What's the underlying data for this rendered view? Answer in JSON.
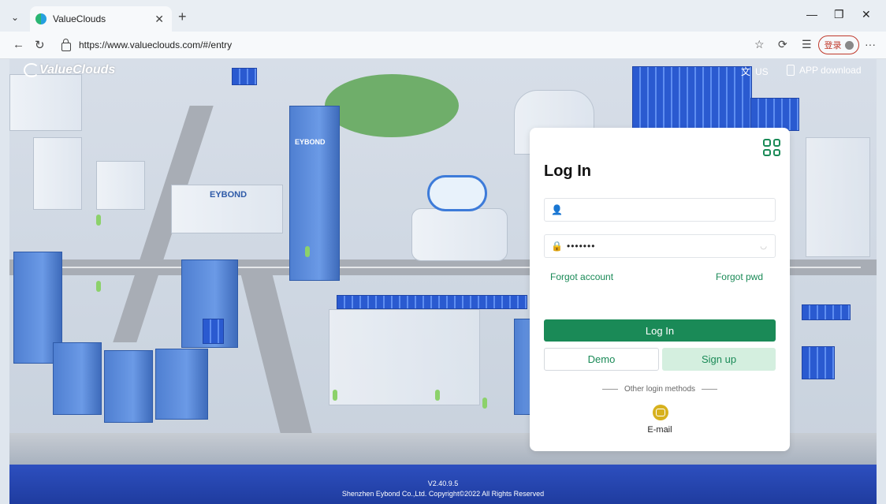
{
  "browser": {
    "tab_title": "ValueClouds",
    "url": "https://www.valueclouds.com/#/entry",
    "login_label": "登录"
  },
  "page": {
    "brand": "ValueClouds",
    "language": "US",
    "app_download": "APP download",
    "building_signs": [
      "EYBOND",
      "EYBOND"
    ],
    "version": "V2.40.9.5",
    "copyright": "Shenzhen Eybond Co.,Ltd. Copyright©2022 All Rights Reserved"
  },
  "login": {
    "title": "Log In",
    "username_value": "",
    "password_value": "•••••••",
    "forgot_account": "Forgot account",
    "forgot_pwd": "Forgot pwd",
    "login_button": "Log In",
    "demo_button": "Demo",
    "signup_button": "Sign up",
    "other_methods": "Other login methods",
    "email_label": "E-mail"
  },
  "colors": {
    "primary": "#1a8a57",
    "primary_light": "#d4efdf",
    "email_icon": "#d7b11e"
  }
}
